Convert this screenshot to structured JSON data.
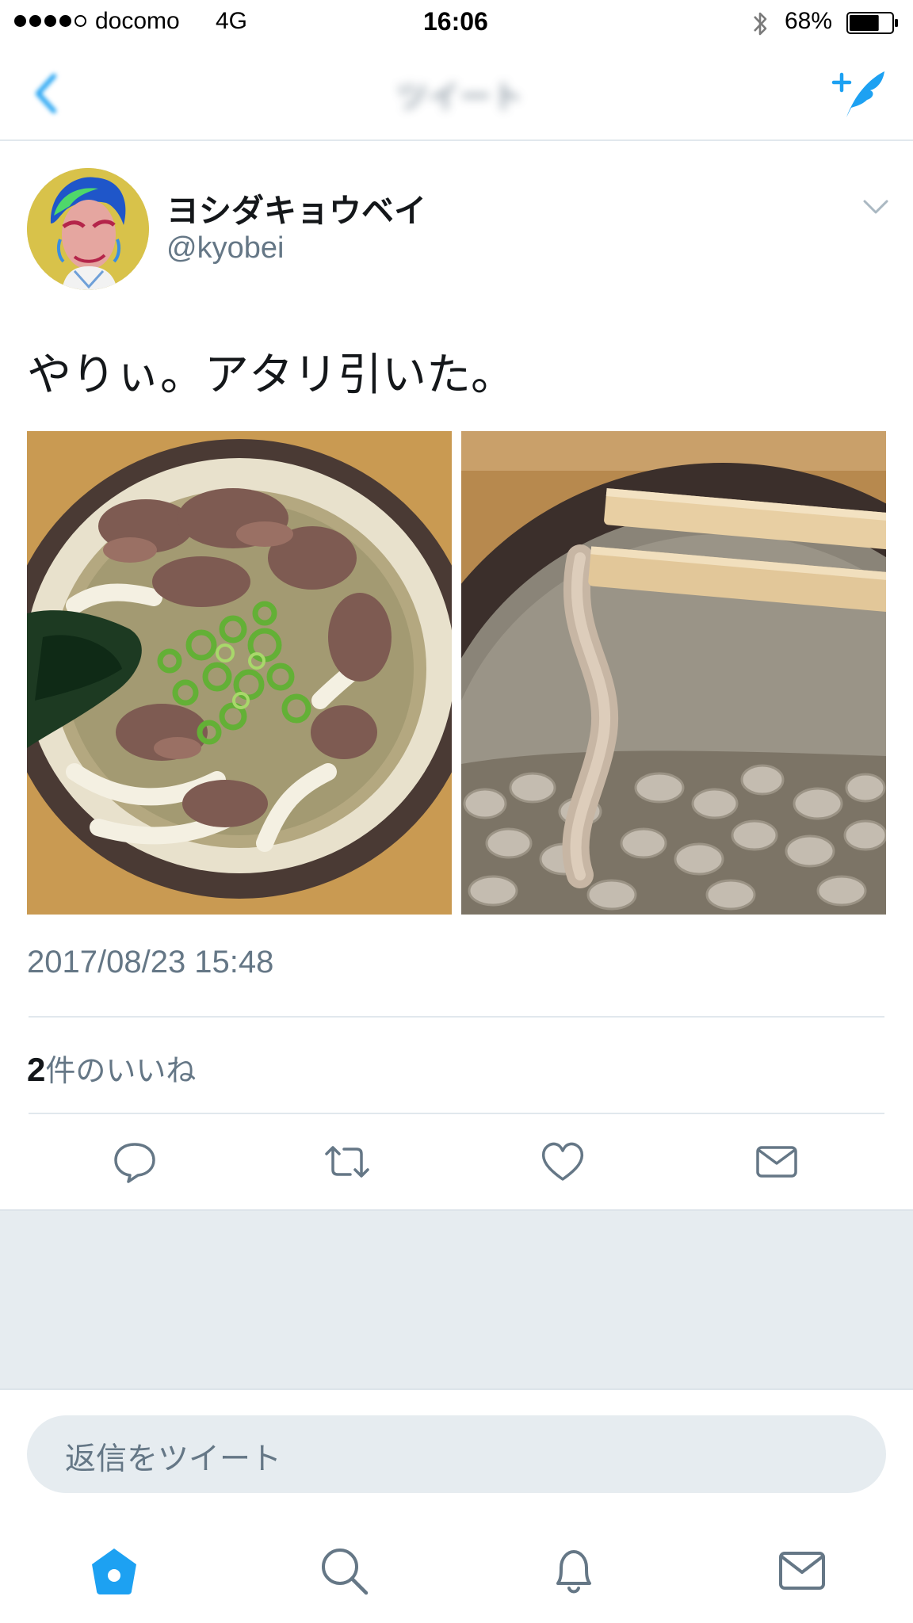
{
  "status_bar": {
    "carrier": "docomo",
    "network": "4G",
    "time": "16:06",
    "battery_percent": "68%",
    "battery_level": 0.68,
    "signal_bars_filled": 4,
    "signal_bars_total": 5
  },
  "nav": {
    "title": "ツイート",
    "back_icon": "chevron-left-icon",
    "compose_icon": "compose-tweet-icon"
  },
  "tweet": {
    "display_name": "ヨシダキョウベイ",
    "handle": "@kyobei",
    "text": "やりぃ。アタリ引いた。",
    "timestamp": "2017/08/23 15:48",
    "likes_count": "2",
    "likes_label": "件のいいね",
    "photos": [
      "beef udon bowl with green onion and wakame",
      "udon noodle lifted with chopsticks over soup"
    ]
  },
  "actions": [
    "reply-icon",
    "retweet-icon",
    "like-icon",
    "direct-message-icon"
  ],
  "reply": {
    "placeholder": "返信をツイート"
  },
  "tab_bar": [
    "home-icon",
    "search-icon",
    "notifications-icon",
    "messages-icon"
  ],
  "colors": {
    "accent": "#1da1f2",
    "secondary_text": "#657786",
    "divider": "#e1e8ed",
    "background_gray": "#e6ecf0"
  }
}
